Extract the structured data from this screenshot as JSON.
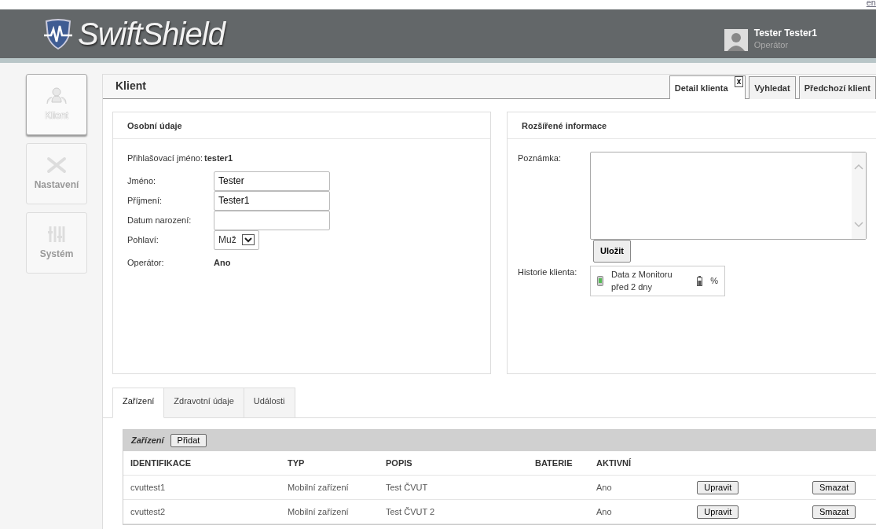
{
  "header": {
    "brand": "SwiftShield",
    "language_link": "en",
    "user": {
      "name": "Tester Tester1",
      "role": "Operátor"
    }
  },
  "sidebar": {
    "items": [
      {
        "label": "Klient",
        "selected": true
      },
      {
        "label": "Nastavení",
        "selected": false
      },
      {
        "label": "Systém",
        "selected": false
      }
    ]
  },
  "page": {
    "title": "Klient",
    "tabs": [
      {
        "label": "Detail klienta",
        "selected": true,
        "close": "x"
      },
      {
        "label": "Vyhledat",
        "selected": false
      },
      {
        "label": "Předchozí klient",
        "selected": false
      }
    ]
  },
  "personal": {
    "title": "Osobní údaje",
    "login_label": "Přihlašovací jméno:",
    "login_value": "tester1",
    "fields": [
      {
        "label": "Jméno:",
        "value": "Tester"
      },
      {
        "label": "Příjmení:",
        "value": "Tester1"
      },
      {
        "label": "Datum narození:"
      }
    ],
    "gender_label": "Pohlaví:",
    "gender_value": "Muž",
    "operator_label": "Operátor:",
    "operator_value": "Ano"
  },
  "extended": {
    "title": "Rozšířené informace",
    "note_label": "Poznámka:",
    "save_button": "Uložit",
    "history_label": "Historie klienta:",
    "history": [
      {
        "title": "Data z Monitoru",
        "time": "před 2 dny",
        "battery": "%"
      }
    ]
  },
  "bottom_tabs": [
    {
      "label": "Zařízení",
      "selected": true
    },
    {
      "label": "Zdravotní údaje",
      "selected": false
    },
    {
      "label": "Události",
      "selected": false
    }
  ],
  "devices": {
    "title": "Zařízení",
    "add_button": "Přidat",
    "columns": [
      "IDENTIFIKACE",
      "TYP",
      "POPIS",
      "BATERIE",
      "AKTIVNÍ"
    ],
    "rows": [
      {
        "identifikace": "cvuttest1",
        "typ": "Mobilní zařízení",
        "popis": "Test ČVUT",
        "aktivni": "Ano",
        "edit": "Upravit",
        "delete": "Smazat"
      },
      {
        "identifikace": "cvuttest2",
        "typ": "Mobilní zařízení",
        "popis": "Test ČVUT 2",
        "aktivni": "Ano",
        "edit": "Upravit",
        "delete": "Smazat"
      }
    ]
  }
}
